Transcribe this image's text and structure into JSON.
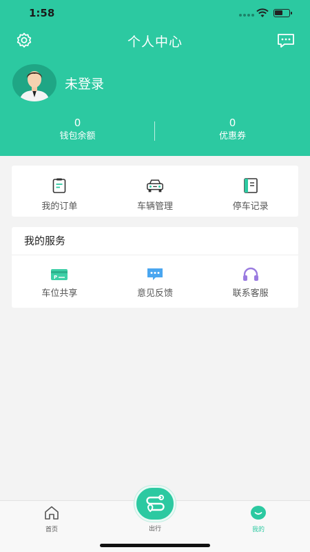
{
  "status_bar": {
    "time": "1:58"
  },
  "header": {
    "title": "个人中心",
    "login_text": "未登录",
    "stats": [
      {
        "value": "0",
        "label": "钱包余额"
      },
      {
        "value": "0",
        "label": "优惠券"
      }
    ]
  },
  "quick_actions": [
    {
      "label": "我的订单",
      "icon": "order-clipboard-icon"
    },
    {
      "label": "车辆管理",
      "icon": "car-icon"
    },
    {
      "label": "停车记录",
      "icon": "record-book-icon"
    }
  ],
  "services": {
    "title": "我的服务",
    "items": [
      {
        "label": "车位共享",
        "icon": "parking-card-icon",
        "color": "#3ccfa6"
      },
      {
        "label": "意见反馈",
        "icon": "chat-bubble-icon",
        "color": "#4aa6f0"
      },
      {
        "label": "联系客服",
        "icon": "headset-icon",
        "color": "#9a7be0"
      }
    ]
  },
  "tabbar": {
    "home": "首页",
    "go": "出行",
    "mine": "我的"
  },
  "colors": {
    "brand": "#2cc9a1"
  }
}
